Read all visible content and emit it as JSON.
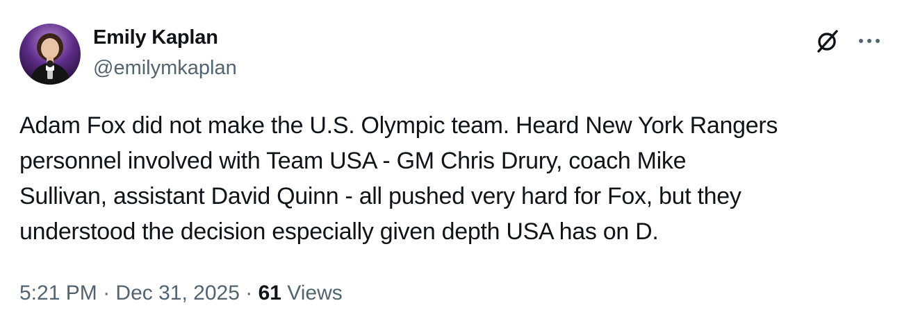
{
  "author": {
    "display_name": "Emily Kaplan",
    "handle": "@emilymkaplan"
  },
  "tweet": {
    "text_lines": [
      "Adam Fox did not make the U.S. Olympic team. Heard New York Rangers",
      "personnel involved with Team USA - GM Chris Drury, coach Mike",
      "Sullivan, assistant David Quinn - all pushed very hard for Fox, but they",
      "understood the decision especially given depth USA has on D."
    ]
  },
  "meta": {
    "time": "5:21 PM",
    "separator": "·",
    "date": "Dec 31, 2025",
    "views_count": "61",
    "views_label": "Views"
  },
  "icons": {
    "grok": "grok-icon",
    "more": "more-icon"
  },
  "colors": {
    "text_primary": "#0f1419",
    "text_secondary": "#536471"
  }
}
